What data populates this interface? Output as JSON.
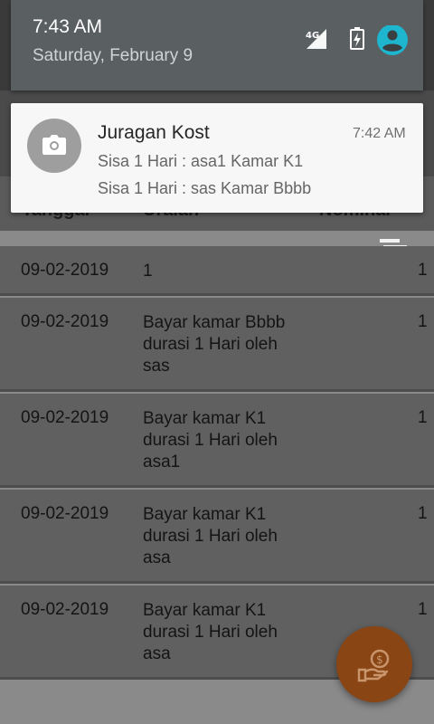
{
  "status_bar": {
    "time": "7:43 AM",
    "date": "Saturday, February 9",
    "network_label": "4G",
    "icons": [
      "signal-icon",
      "battery-charging-icon",
      "account-icon"
    ]
  },
  "notification": {
    "app_name": "Juragan Kost",
    "time": "7:42 AM",
    "lines": [
      "Sisa 1 Hari : asa1 Kamar K1",
      "Sisa 1 Hari : sas Kamar Bbbb"
    ],
    "icon": "camera-icon"
  },
  "table": {
    "headers": {
      "date": "Tanggal",
      "description": "Uraian",
      "amount": "Nominal"
    },
    "rows": [
      {
        "date": "09-02-2019",
        "description": "1",
        "amount": "1"
      },
      {
        "date": "09-02-2019",
        "description": "Bayar kamar Bbbb\ndurasi 1 Hari oleh\nsas",
        "amount": "1"
      },
      {
        "date": "09-02-2019",
        "description": "Bayar kamar K1\ndurasi 1 Hari oleh\nasa1",
        "amount": "1"
      },
      {
        "date": "09-02-2019",
        "description": "Bayar kamar K1\ndurasi 1 Hari oleh\nasa",
        "amount": "1"
      },
      {
        "date": "09-02-2019",
        "description": "Bayar kamar K1\ndurasi 1 Hari oleh\nasa",
        "amount": "1"
      }
    ]
  },
  "fab": {
    "icon": "pay-money-icon"
  },
  "colors": {
    "fab": "#8a4514",
    "account_icon": "#1eb5cf"
  }
}
